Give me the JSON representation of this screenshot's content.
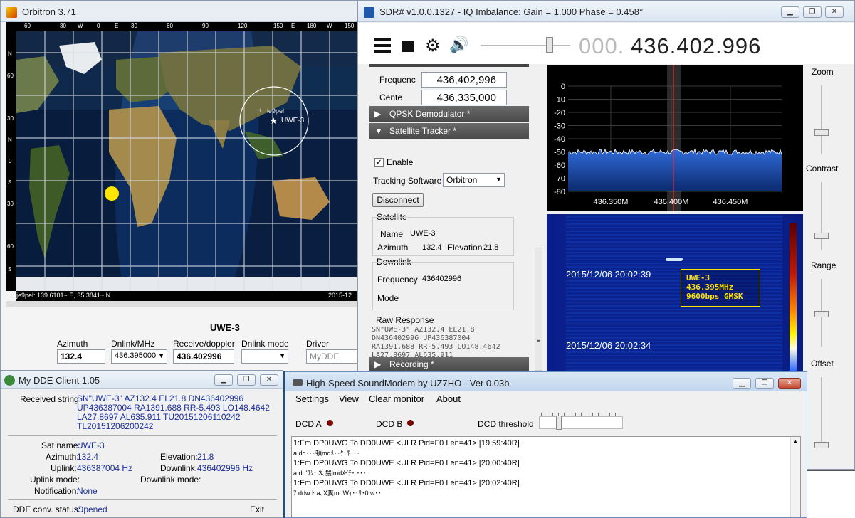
{
  "orbitron": {
    "title": "Orbitron 3.71",
    "lon_ticks": [
      "60",
      "30",
      "W",
      "0",
      "E",
      "30",
      "60",
      "90",
      "120",
      "150",
      "E",
      "180",
      "W",
      "150"
    ],
    "lat_ticks": [
      "N",
      "60",
      "30",
      "N",
      "0",
      "S",
      "30",
      "60",
      "S"
    ],
    "sat_label": "UWE-3",
    "observer_label": "ie9pel",
    "status_left": "je9pel: 139.6101~ E, 35.3841~ N",
    "status_right": "2015-12",
    "panel_title": "UWE-3",
    "azimuth_label": "Azimuth",
    "azimuth_value": "132.4",
    "dnlink_label": "Dnlink/MHz",
    "dnlink_value": "436.395000",
    "receive_label": "Receive/doppler",
    "receive_value": "436.402996",
    "dnlink_mode_label": "Dnlink mode",
    "dnlink_mode_value": "",
    "driver_label": "Driver",
    "driver_value": "MyDDE"
  },
  "sdr": {
    "title": "SDR# v1.0.0.1327 - IQ Imbalance: Gain = 1.000 Phase = 0.458°",
    "freq_dim": "000.",
    "freq_main": "436.402.996",
    "frequency_label": "Frequenc",
    "frequency_value": "436,402,996",
    "center_label": "Cente",
    "center_value": "436,335,000",
    "qpsk_label": "QPSK Demodulator *",
    "tracker_label": "Satellite Tracker *",
    "enable_label": "Enable",
    "tracking_label": "Tracking Software",
    "tracking_value": "Orbitron",
    "disconnect_label": "Disconnect",
    "satellite_group": "Satellite",
    "name_label": "Name",
    "name_value": "UWE-3",
    "azimuth_label": "Azimuth",
    "azimuth_value": "132.4",
    "elevation_label": "Elevation",
    "elevation_value": "21.8",
    "downlink_group": "Downlink",
    "dl_freq_label": "Frequency",
    "dl_freq_value": "436402996",
    "mode_label": "Mode",
    "raw_label": "Raw Response",
    "raw_lines": [
      "SN\"UWE-3\" AZ132.4 EL21.8",
      "DN436402996 UP436387004",
      "RA1391.688 RR-5.493 LO148.4642",
      "LA27.8697 AL635.911"
    ],
    "recording_label": "Recording *",
    "zoom_label": "Zoom",
    "contrast_label": "Contrast",
    "range_label": "Range",
    "offset_label": "Offset",
    "wf_time1": "2015/12/06 20:02:39",
    "wf_time2": "2015/12/06 20:02:34",
    "info_line1": "UWE-3",
    "info_line2": "436.395MHz",
    "info_line3": "9600bps GMSK"
  },
  "chart_data": {
    "type": "line",
    "title": "",
    "xlabel": "",
    "ylabel": "",
    "x_ticks": [
      "436.350M",
      "436.400M",
      "436.450M"
    ],
    "y_ticks": [
      "0",
      "-10",
      "-20",
      "-30",
      "-40",
      "-50",
      "-60",
      "-70",
      "-80"
    ],
    "ylim": [
      -80,
      0
    ],
    "noise_floor_db": -50,
    "marker_freq": "436.402996M"
  },
  "dde": {
    "title": "My DDE Client 1.05",
    "received_label": "Received string:",
    "received_lines": [
      "SN\"UWE-3\" AZ132.4 EL21.8 DN436402996",
      "UP436387004 RA1391.688 RR-5.493 LO148.4642",
      "LA27.8697 AL635.911 TU20151206110242",
      "TL20151206200242"
    ],
    "satname_label": "Sat name:",
    "satname_value": "UWE-3",
    "azimuth_label": "Azimuth:",
    "azimuth_value": "132.4",
    "elevation_label": "Elevation:",
    "elevation_value": "21.8",
    "uplink_label": "Uplink:",
    "uplink_value": "436387004 Hz",
    "downlink_label": "Downlink:",
    "downlink_value": "436402996 Hz",
    "uplink_mode_label": "Uplink mode:",
    "downlink_mode_label": "Downlink mode:",
    "notification_label": "Notification:",
    "notification_value": "None",
    "status_label": "DDE conv. status:",
    "status_value": "Opened",
    "exit_label": "Exit"
  },
  "modem": {
    "title": "High-Speed SoundModem by UZ7HO - Ver 0.03b",
    "menu": [
      "Settings",
      "View",
      "Clear monitor",
      "About"
    ],
    "dcd_a": "DCD A",
    "dcd_b": "DCD B",
    "dcd_threshold": "DCD threshold",
    "monitor": [
      {
        "header": "1:Fm DP0UWG To DD0UWE <UI R Pid=F0 Len=41> [19:59:40R]",
        "payload": "a dd･･･頓mdﾒ･･ｹ･$･･･"
      },
      {
        "header": "1:Fm DP0UWG To DD0UWE <UI R Pid=F0 Len=41> [20:00:40R]",
        "payload": "a dd'ﾜｼ･ 3､猥lmdﾒｲﾁ･.･･･"
      },
      {
        "header": "1:Fm DP0UWG To DD0UWE <UI R Pid=F0 Len=41> [20:02:40R]",
        "payload": "ｱ ddw.ﾄ a､X糞mdWｨ･･ｻ･0 w･･"
      }
    ]
  }
}
